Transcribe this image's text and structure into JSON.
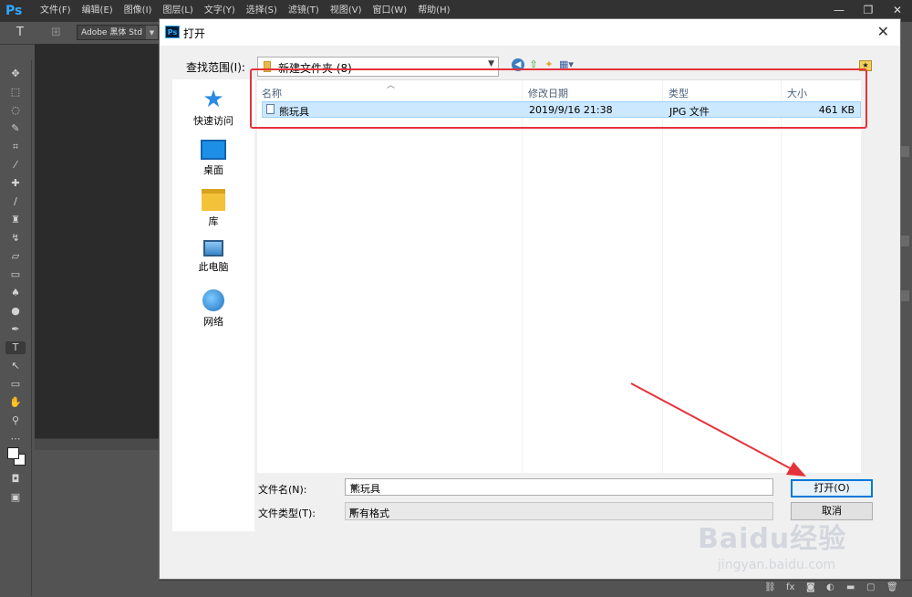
{
  "ps": {
    "logo": "Ps",
    "menu": [
      "文件(F)",
      "编辑(E)",
      "图像(I)",
      "图层(L)",
      "文字(Y)",
      "选择(S)",
      "滤镜(T)",
      "视图(V)",
      "窗口(W)",
      "帮助(H)"
    ],
    "window_controls": {
      "minimize": "—",
      "restore": "❐",
      "close": "✕"
    },
    "options": {
      "tool_glyph": "T",
      "font_family": "Adobe 黑体 Std"
    }
  },
  "dialog": {
    "title": "打开",
    "close_glyph": "✕",
    "look_in_label": "查找范围(I):",
    "look_in_value": "新建文件夹 (8)",
    "places": [
      "快速访问",
      "桌面",
      "库",
      "此电脑",
      "网络"
    ],
    "columns": [
      "名称",
      "修改日期",
      "类型",
      "大小"
    ],
    "files": [
      {
        "name": "熊玩具",
        "modified": "2019/9/16 21:38",
        "type": "JPG 文件",
        "size": "461 KB"
      }
    ],
    "file_name_label": "文件名(N):",
    "file_name_value": "熊玩具",
    "file_type_label": "文件类型(T):",
    "file_type_value": "所有格式",
    "open_button": "打开(O)",
    "cancel_button": "取消"
  },
  "annotation_color": "#e5323a",
  "watermark": {
    "main": "Baidu经验",
    "sub": "jingyan.baidu.com"
  }
}
